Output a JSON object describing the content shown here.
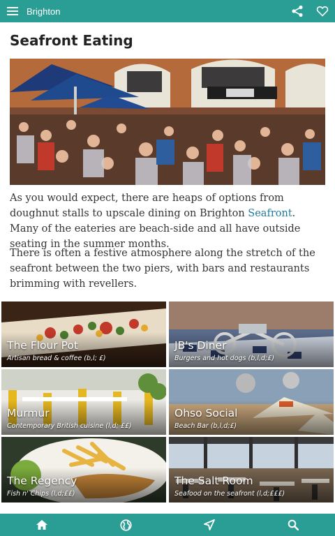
{
  "app": {
    "title": "Brighton",
    "accent_color": "#2a9d94"
  },
  "page": {
    "title": "Seafront Eating",
    "hero_image": "outdoor-cafe-crowd-photo",
    "paragraph_1_before": "As you would expect, there are heaps of options from doughnut stalls to upscale dining on Brighton ",
    "paragraph_1_link": "Seafront",
    "paragraph_1_after": ". Many of the eateries are beach-side and all have outside seating in the summer months.",
    "paragraph_2": "There is often a festive atmosphere along the stretch of the seafront between the two piers, with bars and restaurants brimming with revellers."
  },
  "places": [
    {
      "name": "The Flour Pot",
      "description": "Artisan bread & coffee (b,l; £)"
    },
    {
      "name": "JB's Diner",
      "description": "Burgers and hot dogs (b,l,d;£)"
    },
    {
      "name": "Murmur",
      "description": "Contemporary British cuisine (l,d; ££)"
    },
    {
      "name": "Ohso Social",
      "description": "Beach Bar (b,l,d;£)"
    },
    {
      "name": "The Regency",
      "description": "Fish n' Chips (l,d;££)"
    },
    {
      "name": "The Salt Room",
      "description": "Seafood on the seafront (l,d;£££)"
    }
  ],
  "toolbar": {
    "menu_icon": "hamburger-menu-icon",
    "share_icon": "share-icon",
    "favorite_icon": "heart-icon"
  },
  "bottom_nav": {
    "items": [
      "home-icon",
      "globe-icon",
      "navigation-arrow-icon",
      "search-icon"
    ]
  }
}
